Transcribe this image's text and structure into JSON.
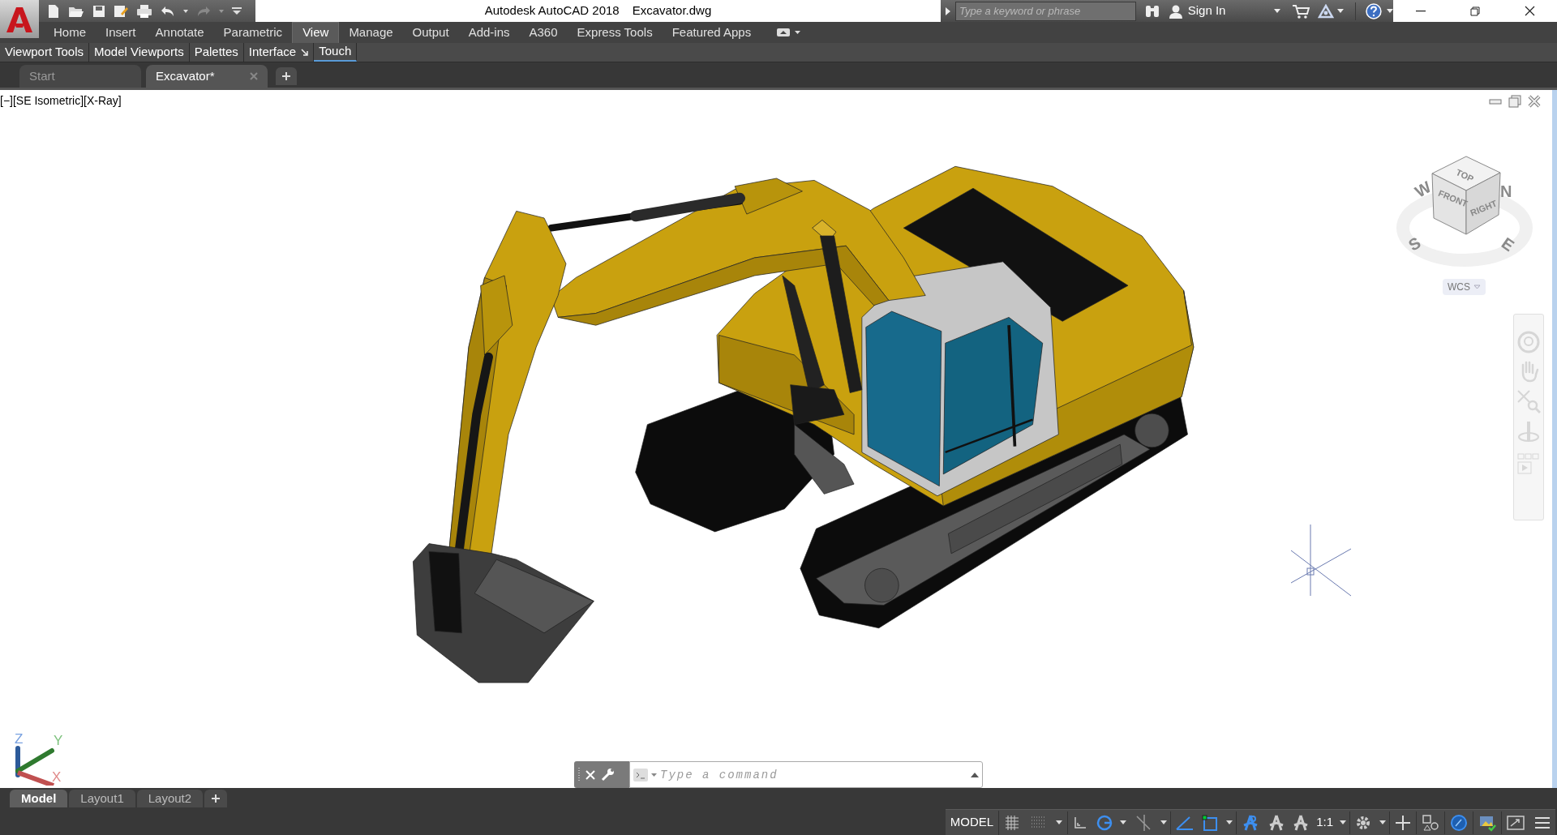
{
  "title_bar": {
    "app_title": "Autodesk AutoCAD 2018",
    "file_name": "Excavator.dwg",
    "search": {
      "placeholder": "Type a keyword or phrase"
    },
    "sign_in": "Sign In"
  },
  "ribbon_tabs": [
    {
      "label": "Home",
      "selected": false
    },
    {
      "label": "Insert",
      "selected": false
    },
    {
      "label": "Annotate",
      "selected": false
    },
    {
      "label": "Parametric",
      "selected": false
    },
    {
      "label": "View",
      "selected": true
    },
    {
      "label": "Manage",
      "selected": false
    },
    {
      "label": "Output",
      "selected": false
    },
    {
      "label": "Add-ins",
      "selected": false
    },
    {
      "label": "A360",
      "selected": false
    },
    {
      "label": "Express Tools",
      "selected": false
    },
    {
      "label": "Featured Apps",
      "selected": false
    }
  ],
  "ribbon_panels": [
    {
      "label": "Viewport Tools",
      "launcher": false,
      "active": false
    },
    {
      "label": "Model Viewports",
      "launcher": false,
      "active": false
    },
    {
      "label": "Palettes",
      "launcher": false,
      "active": false
    },
    {
      "label": "Interface",
      "launcher": true,
      "active": false
    },
    {
      "label": "Touch",
      "launcher": false,
      "active": true
    }
  ],
  "file_tabs": [
    {
      "label": "Start",
      "selected": false
    },
    {
      "label": "Excavator*",
      "selected": true
    }
  ],
  "viewport": {
    "view_label": "[−][SE Isometric][X-Ray]",
    "viewcube": {
      "faces": [
        "TOP",
        "FRONT",
        "RIGHT"
      ],
      "compass": [
        "N",
        "E",
        "S",
        "W"
      ],
      "ucs": "WCS"
    },
    "ucs_axes": [
      "Z",
      "Y",
      "X"
    ]
  },
  "command_line": {
    "placeholder": "Type a command"
  },
  "layout_tabs": [
    {
      "label": "Model",
      "selected": true
    },
    {
      "label": "Layout1",
      "selected": false
    },
    {
      "label": "Layout2",
      "selected": false
    }
  ],
  "status_bar": {
    "space": "MODEL",
    "annotation_scale": "1:1"
  }
}
